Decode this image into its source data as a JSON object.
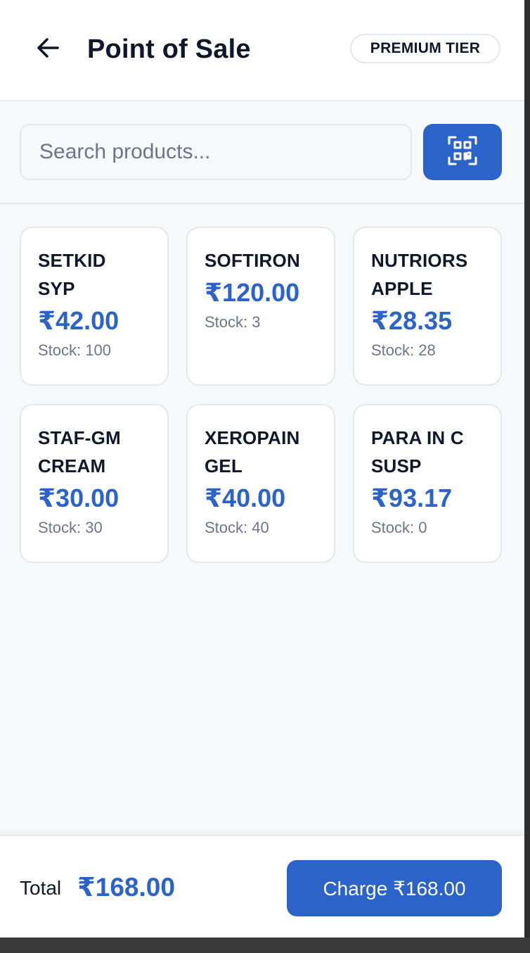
{
  "header": {
    "title": "Point of Sale",
    "tier_badge": "PREMIUM TIER",
    "back_icon": "arrow-left-icon"
  },
  "search": {
    "placeholder": "Search products...",
    "value": "",
    "scan_icon": "qr-scan-icon"
  },
  "products": [
    {
      "name_line1": "SETKID",
      "name_line2": "SYP",
      "price": "₹42.00",
      "stock": "Stock: 100"
    },
    {
      "name_line1": "SOFTIRON",
      "name_line2": "",
      "price": "₹120.00",
      "stock": "Stock: 3"
    },
    {
      "name_line1": "NUTRIORS",
      "name_line2": "APPLE",
      "price": "₹28.35",
      "stock": "Stock: 28"
    },
    {
      "name_line1": "STAF-GM",
      "name_line2": "CREAM",
      "price": "₹30.00",
      "stock": "Stock: 30"
    },
    {
      "name_line1": "XEROPAIN",
      "name_line2": "GEL",
      "price": "₹40.00",
      "stock": "Stock: 40"
    },
    {
      "name_line1": "PARA IN C",
      "name_line2": "SUSP",
      "price": "₹93.17",
      "stock": "Stock: 0"
    }
  ],
  "footer": {
    "total_label": "Total",
    "total_value": "₹168.00",
    "charge_label": "Charge ₹168.00"
  },
  "colors": {
    "accent": "#2c63c8",
    "text_primary": "#0f172a",
    "text_muted": "#6b7689",
    "background": "#f7f8fa"
  }
}
